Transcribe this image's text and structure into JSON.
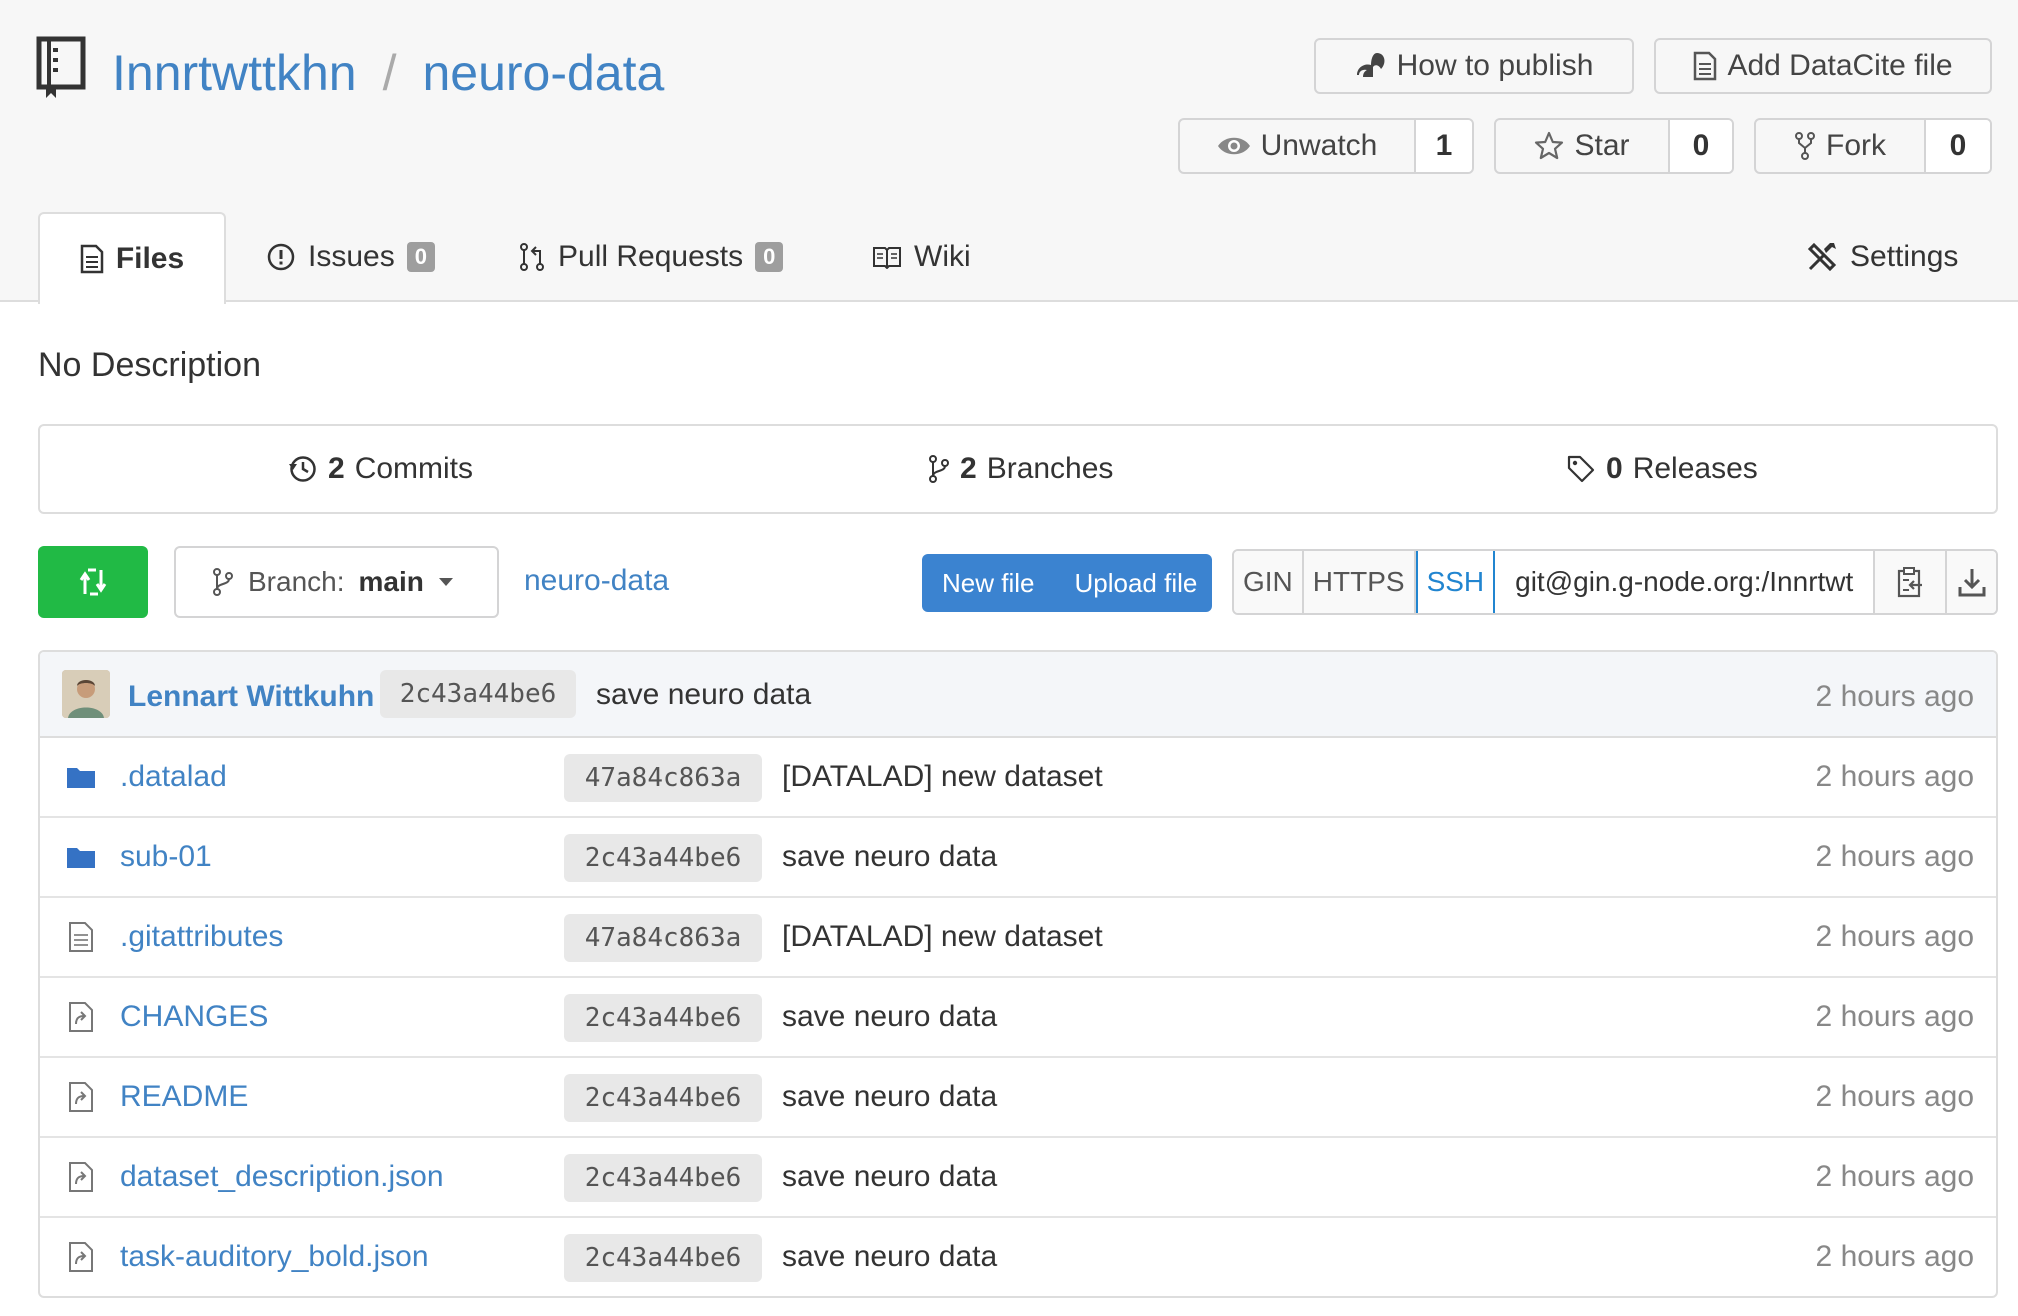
{
  "repo": {
    "owner": "Innrtwttkhn",
    "separator": "/",
    "name": "neuro-data"
  },
  "header_buttons": {
    "how_to_publish": "How to publish",
    "add_datacite": "Add DataCite file"
  },
  "counters": {
    "unwatch": {
      "label": "Unwatch",
      "count": "1"
    },
    "star": {
      "label": "Star",
      "count": "0"
    },
    "fork": {
      "label": "Fork",
      "count": "0"
    }
  },
  "tabs": {
    "files": "Files",
    "issues": {
      "label": "Issues",
      "count": "0"
    },
    "pulls": {
      "label": "Pull Requests",
      "count": "0"
    },
    "wiki": "Wiki",
    "settings": "Settings"
  },
  "description": "No Description",
  "stats": {
    "commits": {
      "count": "2",
      "label": "Commits"
    },
    "branches": {
      "count": "2",
      "label": "Branches"
    },
    "releases": {
      "count": "0",
      "label": "Releases"
    }
  },
  "branch": {
    "prefix": "Branch:",
    "name": "main"
  },
  "path": "neuro-data",
  "file_actions": {
    "new_file": "New file",
    "upload_file": "Upload file"
  },
  "clone": {
    "protocols": [
      "GIN",
      "HTTPS",
      "SSH"
    ],
    "selected": "SSH",
    "url": "git@gin.g-node.org:/Innrtwt"
  },
  "latest_commit": {
    "author": "Lennart Wittkuhn",
    "sha": "2c43a44be6",
    "message": "save neuro data",
    "time": "2 hours ago"
  },
  "files": [
    {
      "name": ".datalad",
      "type": "folder",
      "sha": "47a84c863a",
      "message": "[DATALAD] new dataset",
      "time": "2 hours ago"
    },
    {
      "name": "sub-01",
      "type": "folder",
      "sha": "2c43a44be6",
      "message": "save neuro data",
      "time": "2 hours ago"
    },
    {
      "name": ".gitattributes",
      "type": "file",
      "sha": "47a84c863a",
      "message": "[DATALAD] new dataset",
      "time": "2 hours ago"
    },
    {
      "name": "CHANGES",
      "type": "symlink",
      "sha": "2c43a44be6",
      "message": "save neuro data",
      "time": "2 hours ago"
    },
    {
      "name": "README",
      "type": "symlink",
      "sha": "2c43a44be6",
      "message": "save neuro data",
      "time": "2 hours ago"
    },
    {
      "name": "dataset_description.json",
      "type": "symlink",
      "sha": "2c43a44be6",
      "message": "save neuro data",
      "time": "2 hours ago"
    },
    {
      "name": "task-auditory_bold.json",
      "type": "symlink",
      "sha": "2c43a44be6",
      "message": "save neuro data",
      "time": "2 hours ago"
    }
  ],
  "colors": {
    "link": "#4183c4",
    "accent_blue": "#3b83d0",
    "green": "#21ba45"
  }
}
